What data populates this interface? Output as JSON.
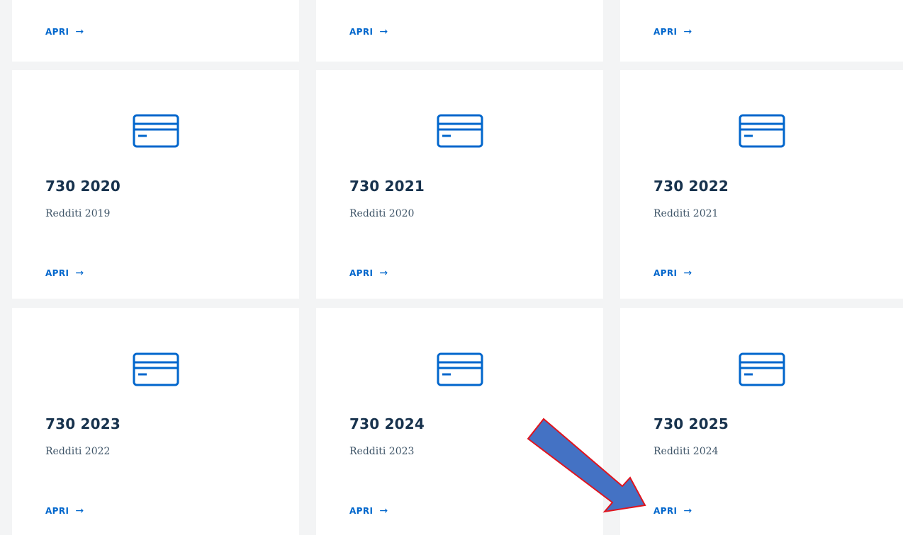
{
  "top_row": [
    {
      "link_label": "APRI",
      "arrow_glyph": "→"
    },
    {
      "link_label": "APRI",
      "arrow_glyph": "→"
    },
    {
      "link_label": "APRI",
      "arrow_glyph": "→"
    }
  ],
  "cards": [
    {
      "title": "730 2020",
      "subtitle": "Redditi 2019",
      "link_label": "APRI",
      "arrow_glyph": "→",
      "icon": "credit-card-icon"
    },
    {
      "title": "730 2021",
      "subtitle": "Redditi 2020",
      "link_label": "APRI",
      "arrow_glyph": "→",
      "icon": "credit-card-icon"
    },
    {
      "title": "730 2022",
      "subtitle": "Redditi 2021",
      "link_label": "APRI",
      "arrow_glyph": "→",
      "icon": "credit-card-icon"
    },
    {
      "title": "730 2023",
      "subtitle": "Redditi 2022",
      "link_label": "APRI",
      "arrow_glyph": "→",
      "icon": "credit-card-icon"
    },
    {
      "title": "730 2024",
      "subtitle": "Redditi 2023",
      "link_label": "APRI",
      "arrow_glyph": "→",
      "icon": "credit-card-icon"
    },
    {
      "title": "730 2025",
      "subtitle": "Redditi 2024",
      "link_label": "APRI",
      "arrow_glyph": "→",
      "icon": "credit-card-icon"
    }
  ],
  "colors": {
    "background": "#f3f4f5",
    "card": "#ffffff",
    "link": "#0066cc",
    "title": "#17324d",
    "icon": "#0066cc",
    "annotation_fill": "#4472c4",
    "annotation_stroke": "#e0141e"
  }
}
